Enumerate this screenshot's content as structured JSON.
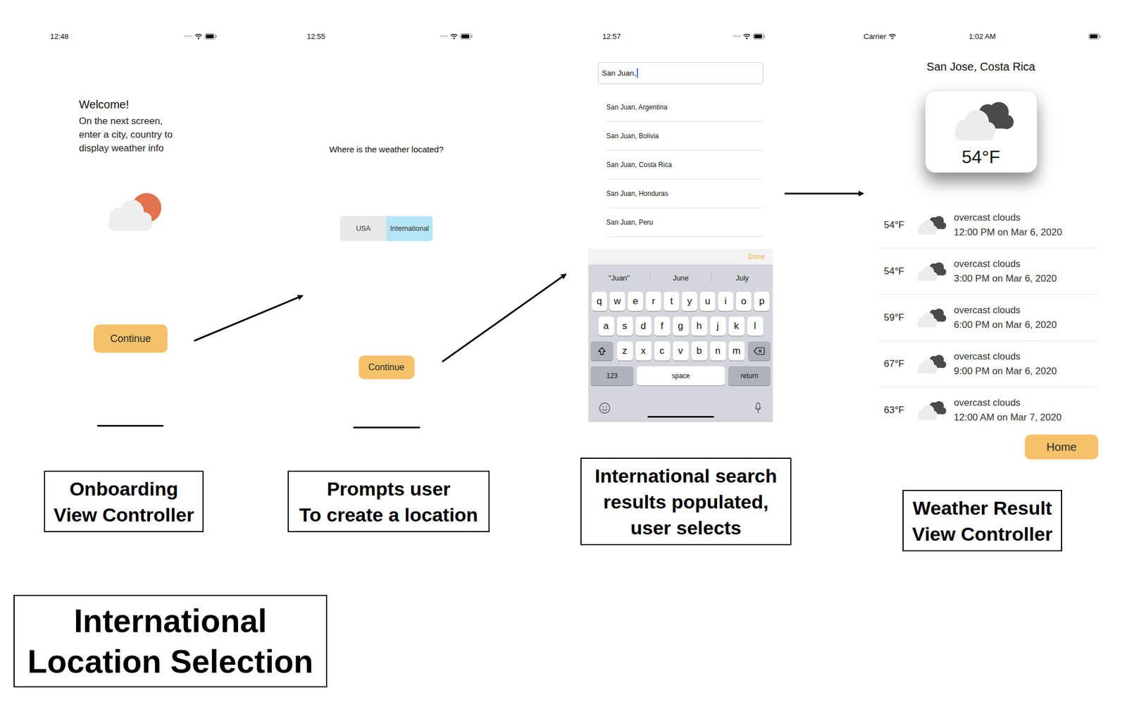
{
  "title": {
    "lines": [
      "International",
      "Location Selection"
    ]
  },
  "onboarding": {
    "status_bar": {
      "time": "12:48"
    },
    "heading": "Welcome!",
    "body": [
      "On the next screen,",
      "enter a city, country to",
      "display weather info"
    ],
    "button": "Continue"
  },
  "location_prompt": {
    "status_bar": {
      "time": "12:55"
    },
    "question": "Where is the weather located?",
    "options": [
      {
        "label": "USA",
        "selected": false
      },
      {
        "label": "International",
        "selected": true
      }
    ],
    "button": "Continue"
  },
  "search": {
    "status_bar": {
      "time": "12:57"
    },
    "query": "San Juan,",
    "results": [
      "San Juan, Argentina",
      "San Juan, Bolivia",
      "San Juan, Costa Rica",
      "San Juan, Honduras",
      "San Juan, Peru"
    ],
    "keyboard": {
      "done": "Done",
      "suggestions": [
        "\"Juan\"",
        "June",
        "July"
      ],
      "rows": [
        [
          "q",
          "w",
          "e",
          "r",
          "t",
          "y",
          "u",
          "i",
          "o",
          "p"
        ],
        [
          "a",
          "s",
          "d",
          "f",
          "g",
          "h",
          "j",
          "k",
          "l"
        ],
        [
          "z",
          "x",
          "c",
          "v",
          "b",
          "n",
          "m"
        ]
      ],
      "number_key": "123",
      "space_key": "space",
      "return_key": "return"
    }
  },
  "weather": {
    "status_bar": {
      "carrier": "Carrier",
      "time": "1:02 AM"
    },
    "location": "San Jose, Costa Rica",
    "current": "54°F",
    "forecast": [
      {
        "temp": "54°F",
        "description": "overcast clouds",
        "time": "12:00 PM on Mar 6, 2020"
      },
      {
        "temp": "54°F",
        "description": "overcast clouds",
        "time": "3:00 PM on Mar 6, 2020"
      },
      {
        "temp": "59°F",
        "description": "overcast clouds",
        "time": "6:00 PM on Mar 6, 2020"
      },
      {
        "temp": "67°F",
        "description": "overcast clouds",
        "time": "9:00 PM on Mar 6, 2020"
      },
      {
        "temp": "63°F",
        "description": "overcast clouds",
        "time": "12:00 AM on Mar 7, 2020"
      }
    ],
    "button": "Home"
  },
  "labels": [
    {
      "lines": [
        "Onboarding",
        "View Controller"
      ]
    },
    {
      "lines": [
        "Prompts user",
        "To create a location"
      ]
    },
    {
      "lines": [
        "International search",
        "results populated,",
        "user selects"
      ]
    },
    {
      "lines": [
        "Weather Result",
        "View Controller"
      ]
    }
  ]
}
